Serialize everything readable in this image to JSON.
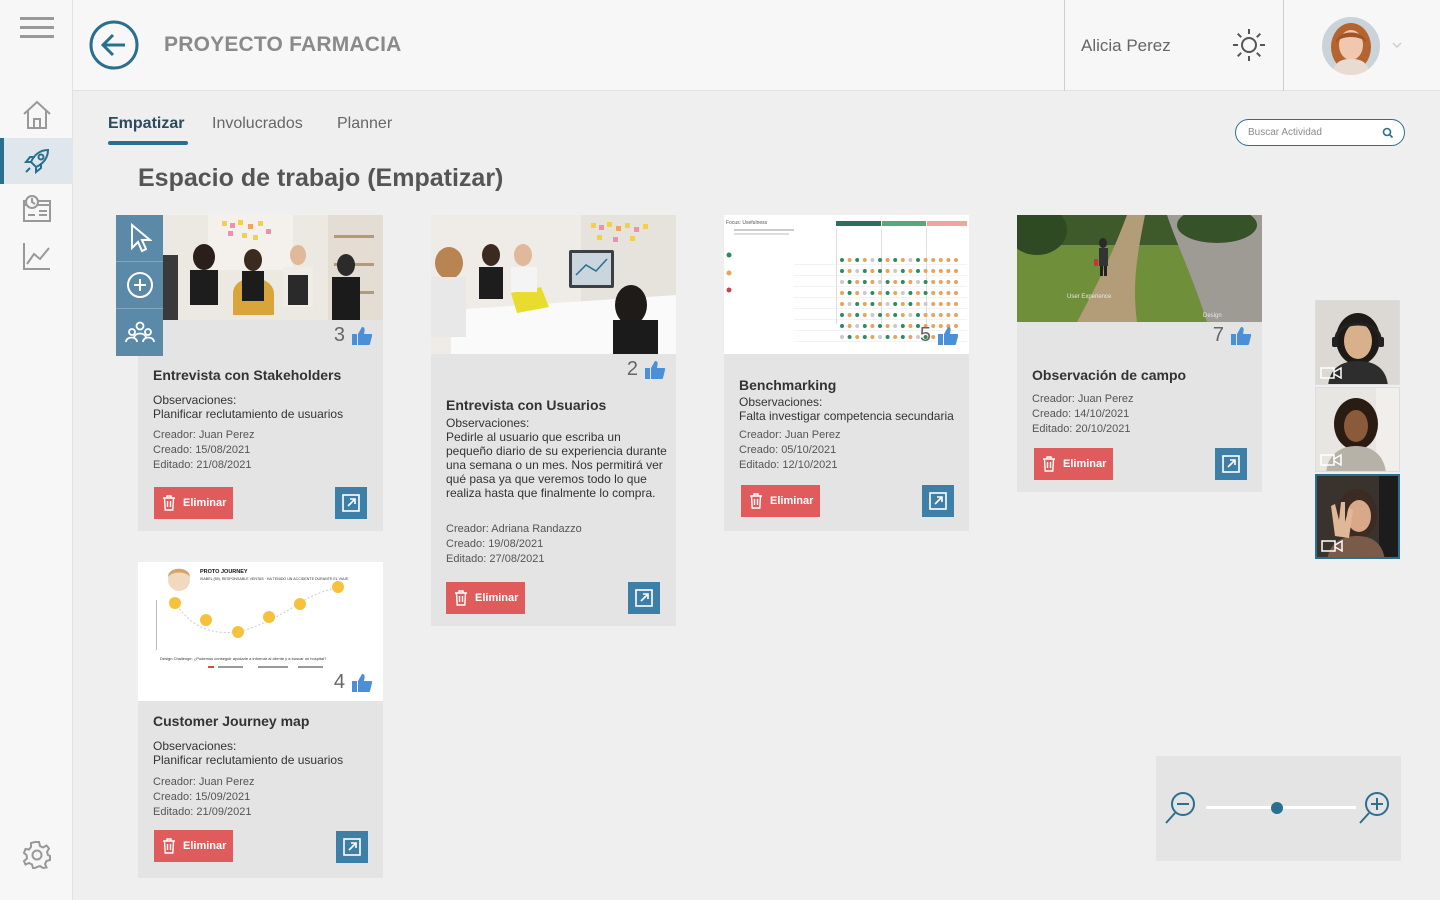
{
  "header": {
    "project_title": "PROYECTO FARMACIA",
    "user_name": "Alicia Perez"
  },
  "sidebar": {
    "items": [
      {
        "icon": "menu-icon"
      },
      {
        "icon": "home-icon"
      },
      {
        "icon": "rocket-icon",
        "active": true
      },
      {
        "icon": "dashboard-icon"
      },
      {
        "icon": "chart-icon"
      },
      {
        "icon": "gear-icon"
      }
    ]
  },
  "tabs": [
    {
      "label": "Empatizar",
      "active": true
    },
    {
      "label": "Involucrados"
    },
    {
      "label": "Planner"
    }
  ],
  "search": {
    "placeholder": "Buscar Actividad"
  },
  "workspace_title": "Espacio de trabajo (Empatizar)",
  "cards": [
    {
      "title": "Entrevista con Stakeholders",
      "likes": "3",
      "obs_label": "Observaciones:",
      "obs": "Planificar reclutamiento de usuarios",
      "creator": "Creador: Juan Perez",
      "created": "Creado: 15/08/2021",
      "edited": "Editado: 21/08/2021",
      "delete_label": "Eliminar"
    },
    {
      "title": "Entrevista con Usuarios",
      "likes": "2",
      "obs_label": "Observaciones:",
      "obs": "Pedirle al usuario que escriba un pequeño diario de su experiencia durante una semana o un mes. Nos permitirá ver qué pasa ya que veremos todo lo que realiza hasta que finalmente lo compra.",
      "creator": "Creador: Adriana Randazzo",
      "created": "Creado: 19/08/2021",
      "edited": "Editado: 27/08/2021",
      "delete_label": "Eliminar"
    },
    {
      "title": "Benchmarking",
      "likes": "5",
      "obs_label": "Observaciones:",
      "obs": "Falta investigar competencia secundaria",
      "creator": "Creador: Juan Perez",
      "created": "Creado: 05/10/2021",
      "edited": "Editado: 12/10/2021",
      "delete_label": "Eliminar"
    },
    {
      "title": "Observación de campo",
      "likes": "7",
      "creator": "Creador: Juan Perez",
      "created": "Creado: 14/10/2021",
      "edited": "Editado: 20/10/2021",
      "delete_label": "Eliminar",
      "image_text_1": "User Experience",
      "image_text_2": "Design"
    },
    {
      "title": "Customer Journey map",
      "likes": "4",
      "obs_label": "Observaciones:",
      "obs": "Planificar reclutamiento de usuarios",
      "creator": "Creador: Juan Perez",
      "created": "Creado: 15/09/2021",
      "edited": "Editado: 21/09/2021",
      "delete_label": "Eliminar",
      "journey_title": "PROTO JOURNEY",
      "journey_subtitle": "ISABEL (55), RESPONSABLE VENTAS · HA TENIDO UN ACCIDENTE DURANTE EL VIAJE",
      "journey_challenge": "Design Challenge: ¿Podemos conseguir ayudarle a informar al cliente y a buscar un hospital?"
    }
  ],
  "benchmark_image": {
    "heading": "Focus: Usefulness"
  },
  "tool_palette": [
    "cursor-icon",
    "add-circle-icon",
    "group-icon"
  ],
  "video_participants": 3,
  "zoom": {
    "level": 0.47
  },
  "colors": {
    "accent": "#2b6f8e",
    "danger": "#e05c5c",
    "open_button": "#3d7fa6",
    "like": "#4a8fd8"
  }
}
